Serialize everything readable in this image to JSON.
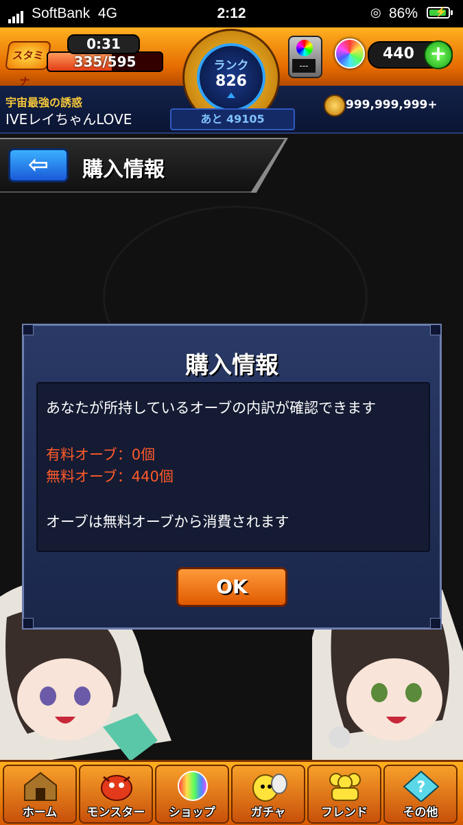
{
  "status_bar": {
    "carrier": "SoftBank",
    "network": "4G",
    "time": "2:12",
    "battery_percent": "86%"
  },
  "top_hud": {
    "stamina_label": "スタミナ",
    "stamina_timer": "0:31",
    "stamina_value": "335/595",
    "stamina_fill_fraction": 0.563,
    "rank_label": "ランク",
    "rank_value": "826",
    "rank_remaining": "あと 49105",
    "gauge_screen": "---",
    "orb_count": "440",
    "plus_label": "+",
    "player_title": "宇宙最強の誘惑",
    "player_name": "IVEレイちゃんLOVE",
    "coin_amount": "999,999,999+"
  },
  "header": {
    "back_arrow": "⇦",
    "title": "購入情報"
  },
  "dialog": {
    "title": "購入情報",
    "description": "あなたが所持しているオーブの内訳が確認できます",
    "paid_orbs": "有料オーブ：0個",
    "free_orbs": "無料オーブ：440個",
    "note": "オーブは無料オーブから消費されます",
    "ok_label": "OK"
  },
  "bottom_nav": {
    "items": [
      {
        "label": "ホーム",
        "icon": "home-icon"
      },
      {
        "label": "モンスター",
        "icon": "monster-icon"
      },
      {
        "label": "ショップ",
        "icon": "orb-icon"
      },
      {
        "label": "ガチャ",
        "icon": "egg-icon"
      },
      {
        "label": "フレンド",
        "icon": "friends-icon"
      },
      {
        "label": "その他",
        "icon": "other-icon"
      }
    ]
  }
}
